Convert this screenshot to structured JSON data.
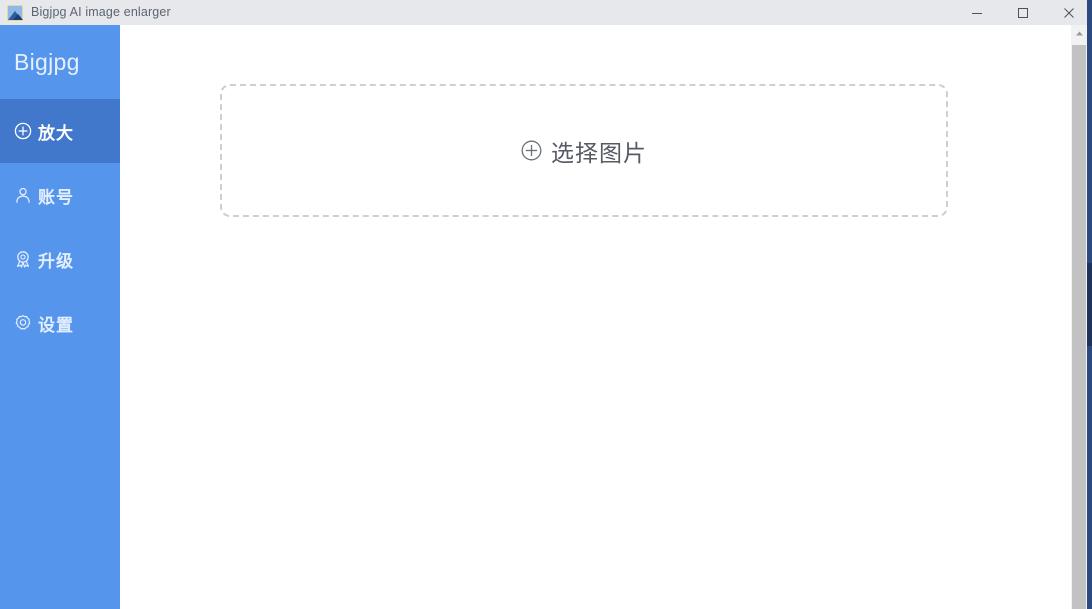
{
  "window": {
    "title": "Bigjpg AI image enlarger",
    "app_icon": "image-mountain-icon",
    "controls": [
      {
        "name": "minimize",
        "icon": "minimize-icon"
      },
      {
        "name": "maximize",
        "icon": "maximize-icon"
      },
      {
        "name": "close",
        "icon": "close-icon"
      }
    ]
  },
  "sidebar": {
    "brand": "Bigjpg",
    "background_color": "#5596ec",
    "active_color": "#4178cc",
    "items": [
      {
        "label": "放大",
        "icon": "plus-circle-icon",
        "active": true
      },
      {
        "label": "账号",
        "icon": "user-icon",
        "active": false
      },
      {
        "label": "升级",
        "icon": "medal-icon",
        "active": false
      },
      {
        "label": "设置",
        "icon": "gear-icon",
        "active": false
      }
    ]
  },
  "main": {
    "dropzone": {
      "label": "选择图片",
      "icon": "plus-circle-icon",
      "border_color": "#cfcfcf"
    }
  },
  "scrollbar": {
    "up_arrow_icon": "caret-up-icon",
    "track_color": "#f2f2f2",
    "thumb_color": "#c2c2c2"
  }
}
